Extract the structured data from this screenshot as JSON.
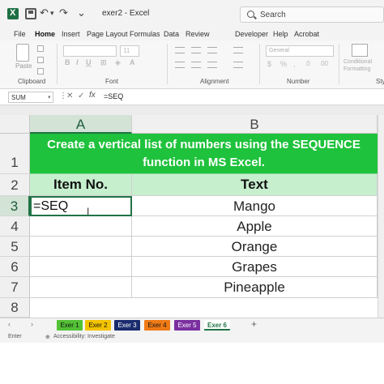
{
  "window": {
    "title": "exer2 - Excel",
    "search_placeholder": "Search"
  },
  "menu": [
    "File",
    "Home",
    "Insert",
    "Page Layout",
    "Formulas",
    "Data",
    "Review",
    "Developer",
    "Help",
    "Acrobat"
  ],
  "menu_active": "Home",
  "ribbon": {
    "paste_label": "Paste",
    "clipboard_label": "Clipboard",
    "font_size": "11",
    "font_label": "Font",
    "alignment_label": "Alignment",
    "number_format": "General",
    "number_label": "Number",
    "conditional_formatting_label": "Conditional Formatting",
    "styles_label": "Sty"
  },
  "formula_bar": {
    "name_box": "SUM",
    "fx_label": "fx",
    "formula": "=SEQ"
  },
  "grid": {
    "columns": [
      "A",
      "B"
    ],
    "rows": [
      "1",
      "2",
      "3",
      "4",
      "5",
      "6",
      "7",
      "8"
    ],
    "title_line1": "Create a vertical list of numbers using the SEQUENCE",
    "title_line2": "function in MS Excel.",
    "header_a": "Item No.",
    "header_b": "Text",
    "active_cell_text": "=SEQ",
    "items": [
      "Mango",
      "Apple",
      "Orange",
      "Grapes",
      "Pineapple"
    ]
  },
  "sheet_tabs": [
    {
      "name": "Exer 1",
      "color": "#53c236"
    },
    {
      "name": "Exer 2",
      "color": "#f4c300"
    },
    {
      "name": "Exer 3",
      "color": "#1a2c6e"
    },
    {
      "name": "Exer 4",
      "color": "#ef7a16"
    },
    {
      "name": "Exer 5",
      "color": "#7a2fa0"
    },
    {
      "name": "Exer 6",
      "color": "#ffffff"
    }
  ],
  "status": {
    "mode": "Enter",
    "accessibility": "Accessibility: Investigate"
  },
  "colors": {
    "accent": "#217346",
    "title_fill": "#1fc23c",
    "header_fill": "#c6efce"
  }
}
